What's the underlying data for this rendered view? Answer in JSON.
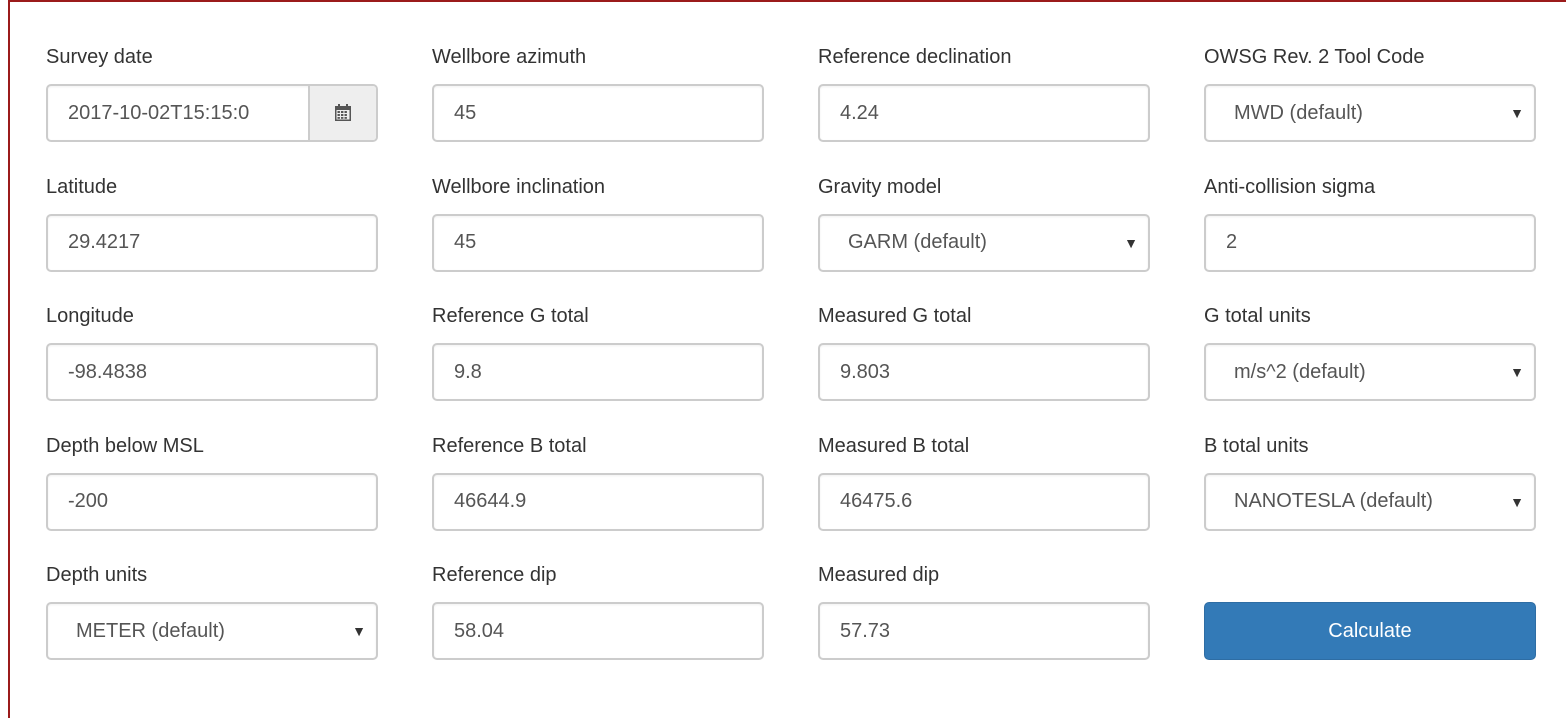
{
  "form": {
    "survey_date": {
      "label": "Survey date",
      "value": "2017-10-02T15:15:0"
    },
    "wellbore_azimuth": {
      "label": "Wellbore azimuth",
      "value": "45"
    },
    "reference_declination": {
      "label": "Reference declination",
      "value": "4.24"
    },
    "tool_code": {
      "label": "OWSG Rev. 2 Tool Code",
      "value": "MWD (default)"
    },
    "latitude": {
      "label": "Latitude",
      "value": "29.4217"
    },
    "wellbore_inclination": {
      "label": "Wellbore inclination",
      "value": "45"
    },
    "gravity_model": {
      "label": "Gravity model",
      "value": "GARM (default)"
    },
    "anti_collision_sigma": {
      "label": "Anti-collision sigma",
      "value": "2"
    },
    "longitude": {
      "label": "Longitude",
      "value": "-98.4838"
    },
    "reference_g_total": {
      "label": "Reference G total",
      "value": "9.8"
    },
    "measured_g_total": {
      "label": "Measured G total",
      "value": "9.803"
    },
    "g_total_units": {
      "label": "G total units",
      "value": "m/s^2 (default)"
    },
    "depth_below_msl": {
      "label": "Depth below MSL",
      "value": "-200"
    },
    "reference_b_total": {
      "label": "Reference B total",
      "value": "46644.9"
    },
    "measured_b_total": {
      "label": "Measured B total",
      "value": "46475.6"
    },
    "b_total_units": {
      "label": "B total units",
      "value": "NANOTESLA (default)"
    },
    "depth_units": {
      "label": "Depth units",
      "value": "METER (default)"
    },
    "reference_dip": {
      "label": "Reference dip",
      "value": "58.04"
    },
    "measured_dip": {
      "label": "Measured dip",
      "value": "57.73"
    },
    "calculate_label": "Calculate"
  },
  "icons": {
    "calendar": "calendar-icon",
    "caret": "caret-down-icon"
  },
  "colors": {
    "frame_border": "#9b1b1b",
    "primary_button": "#337ab7",
    "input_border": "#cccccc",
    "addon_bg": "#eeeeee"
  }
}
